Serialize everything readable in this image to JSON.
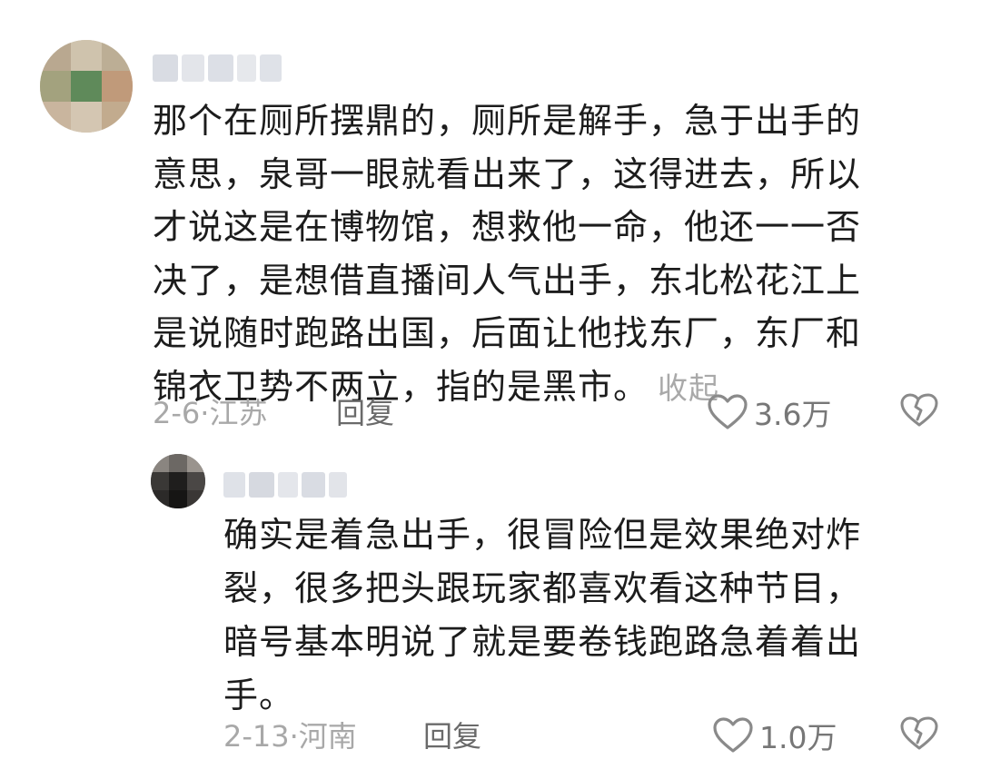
{
  "comment": {
    "username": "",
    "text_lines": [
      "那个在厕所摆鼎的，厕所是解手，急于出手的",
      "意思，泉哥一眼就看出来了，这得进去，所以",
      "才说这是在博物馆，想救他一命，他还一一否",
      "决了，是想借直播间人气出手，东北松花江上",
      "是说随时跑路出国，后面让他找东厂，东厂和",
      "锦衣卫势不两立，指的是黑市。"
    ],
    "collapse_label": "收起",
    "date": "2-6",
    "location": "江苏",
    "reply_label": "回复",
    "like_count": "3.6万",
    "icons": {
      "like": "heart-icon",
      "dislike": "broken-heart-icon"
    }
  },
  "reply": {
    "username": "",
    "text_lines": [
      "确实是着急出手，很冒险但是效果绝对炸",
      "裂，很多把头跟玩家都喜欢看这种节目，",
      "暗号基本明说了就是要卷钱跑路急着着出",
      "手。"
    ],
    "date": "2-13",
    "location": "河南",
    "reply_label": "回复",
    "like_count": "1.0万",
    "icons": {
      "like": "heart-icon",
      "dislike": "broken-heart-icon"
    }
  },
  "colors": {
    "text_primary": "#1c1c1c",
    "text_secondary": "#a8a8a8",
    "reply_link": "#6a6a6a",
    "icon": "#8a8a8a"
  }
}
